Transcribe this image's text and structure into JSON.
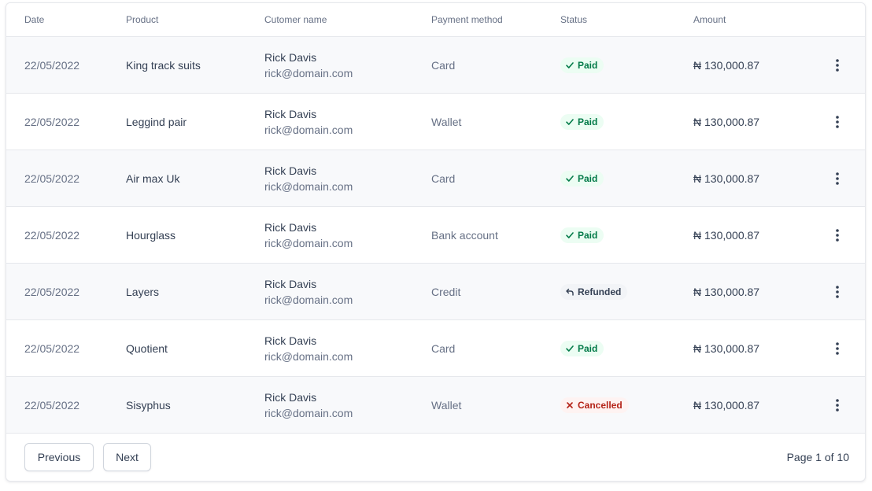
{
  "table": {
    "columns": [
      "Date",
      "Product",
      "Cutomer name",
      "Payment method",
      "Status",
      "Amount"
    ],
    "rows": [
      {
        "date": "22/05/2022",
        "product": "King track suits",
        "customer_name": "Rick Davis",
        "customer_email": "rick@domain.com",
        "payment_method": "Card",
        "status": "Paid",
        "amount": "₦ 130,000.87"
      },
      {
        "date": "22/05/2022",
        "product": "Leggind pair",
        "customer_name": "Rick Davis",
        "customer_email": "rick@domain.com",
        "payment_method": "Wallet",
        "status": "Paid",
        "amount": "₦ 130,000.87"
      },
      {
        "date": "22/05/2022",
        "product": "Air max Uk",
        "customer_name": "Rick Davis",
        "customer_email": "rick@domain.com",
        "payment_method": "Card",
        "status": "Paid",
        "amount": "₦ 130,000.87"
      },
      {
        "date": "22/05/2022",
        "product": "Hourglass",
        "customer_name": "Rick Davis",
        "customer_email": "rick@domain.com",
        "payment_method": "Bank account",
        "status": "Paid",
        "amount": "₦ 130,000.87"
      },
      {
        "date": "22/05/2022",
        "product": "Layers",
        "customer_name": "Rick Davis",
        "customer_email": "rick@domain.com",
        "payment_method": "Credit",
        "status": "Refunded",
        "amount": "₦ 130,000.87"
      },
      {
        "date": "22/05/2022",
        "product": "Quotient",
        "customer_name": "Rick Davis",
        "customer_email": "rick@domain.com",
        "payment_method": "Card",
        "status": "Paid",
        "amount": "₦ 130,000.87"
      },
      {
        "date": "22/05/2022",
        "product": "Sisyphus",
        "customer_name": "Rick Davis",
        "customer_email": "rick@domain.com",
        "payment_method": "Wallet",
        "status": "Cancelled",
        "amount": "₦ 130,000.87"
      }
    ]
  },
  "status_styles": {
    "Paid": {
      "class": "paid",
      "icon": "check-icon",
      "color": "#027a48",
      "bg": "#ecfdf3"
    },
    "Refunded": {
      "class": "refunded",
      "icon": "undo-arrow-icon",
      "color": "#344054",
      "bg": "#f2f4f7"
    },
    "Cancelled": {
      "class": "cancelled",
      "icon": "x-icon",
      "color": "#b42318",
      "bg": "#fef3f2"
    }
  },
  "row_action_icon": "more-vertical-icon",
  "pagination": {
    "previous_label": "Previous",
    "next_label": "Next",
    "page_info": "Page 1 of 10"
  }
}
